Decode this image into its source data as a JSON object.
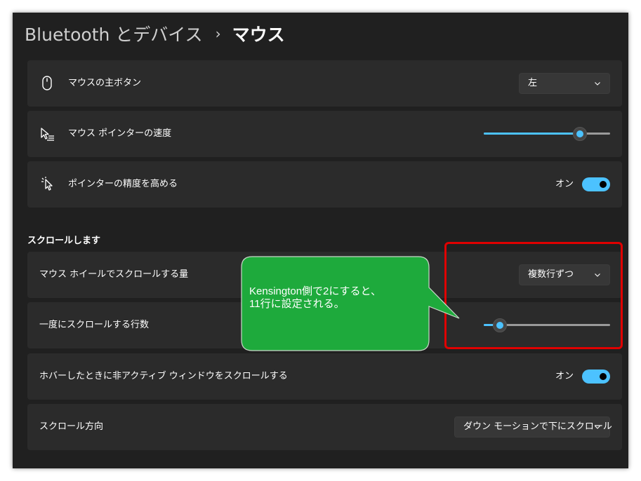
{
  "breadcrumb": {
    "parent": "Bluetooth とデバイス",
    "separator": "›",
    "current": "マウス"
  },
  "rows": {
    "primary_button": {
      "label": "マウスの主ボタン",
      "icon": "mouse-icon",
      "value": "左"
    },
    "pointer_speed": {
      "label": "マウス ポインターの速度",
      "icon": "pointer-speed-icon",
      "level": 0.76
    },
    "pointer_precision": {
      "label": "ポインターの精度を高める",
      "icon": "pointer-precision-icon",
      "state_text": "オン",
      "on": true
    }
  },
  "scroll_section": {
    "heading": "スクロールします",
    "wheel_amount": {
      "label": "マウス ホイールでスクロールする量",
      "value": "複数行ずつ"
    },
    "lines_per_scroll": {
      "label": "一度にスクロールする行数",
      "level": 0.13
    },
    "inactive_scroll": {
      "label": "ホバーしたときに非アクティブ ウィンドウをスクロールする",
      "state_text": "オン",
      "on": true
    },
    "scroll_direction": {
      "label": "スクロール方向",
      "value": "ダウン モーションで下にスクロール"
    }
  },
  "annotation": {
    "line1": "Kensington側で2にすると、",
    "line2": "11行に設定される。"
  },
  "colors": {
    "window_bg": "#202020",
    "card_bg": "#2b2b2b",
    "accent": "#4cc2ff",
    "callout_fill": "#1eaa3c",
    "highlight_border": "#e00000"
  }
}
